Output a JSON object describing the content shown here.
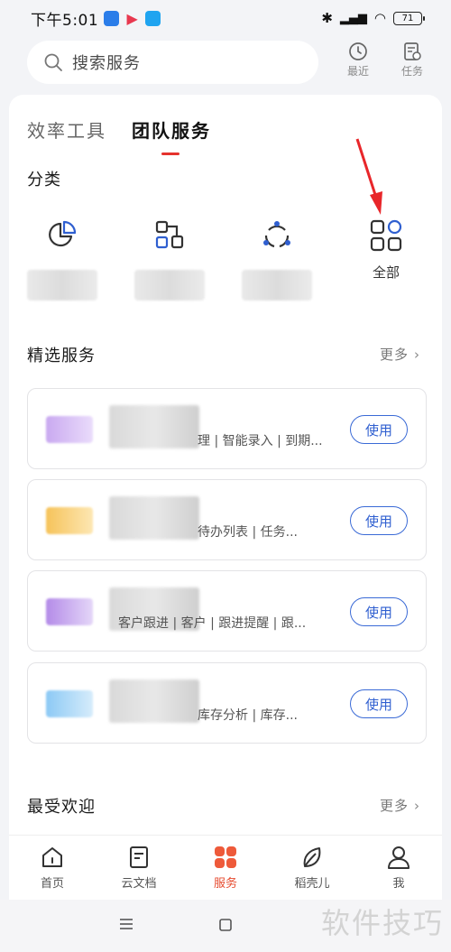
{
  "status_bar": {
    "time": "下午5:01",
    "battery": "71"
  },
  "search": {
    "placeholder": "搜索服务"
  },
  "top_actions": {
    "recent": "最近",
    "tasks": "任务"
  },
  "tabs": [
    {
      "label": "效率工具"
    },
    {
      "label": "团队服务"
    }
  ],
  "categories": {
    "title": "分类",
    "all_label": "全部"
  },
  "featured": {
    "title": "精选服务",
    "more": "更多",
    "use_label": "使用",
    "items": [
      {
        "desc": "理 | 智能录入 | 到期...",
        "thumb_color": "#c9a9f0"
      },
      {
        "desc": "待办列表 | 任务...",
        "thumb_color": "#f6c35a"
      },
      {
        "desc": "客户跟进 | 客户 | 跟进提醒 | 跟...",
        "thumb_color": "#b48be8"
      },
      {
        "desc": "库存分析 | 库存...",
        "thumb_color": "#8cc9f5"
      }
    ]
  },
  "popular": {
    "title": "最受欢迎",
    "more": "更多"
  },
  "bottom_nav": [
    {
      "label": "首页"
    },
    {
      "label": "云文档"
    },
    {
      "label": "服务"
    },
    {
      "label": "稻壳儿"
    },
    {
      "label": "我"
    }
  ],
  "watermark": "软件技巧",
  "colors": {
    "accent_red": "#e5322d",
    "use_blue": "#2f5fd0",
    "nav_active": "#e64a2e"
  }
}
